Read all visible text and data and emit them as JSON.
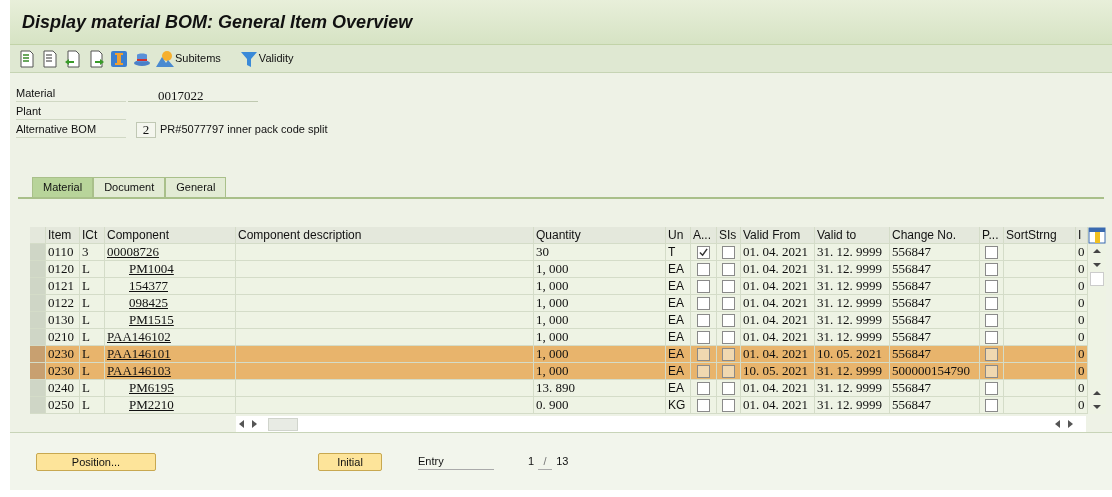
{
  "window": {
    "title": "Display material BOM: General Item Overview"
  },
  "toolbar": [
    {
      "kind": "icon"
    },
    {
      "kind": "icon"
    },
    {
      "kind": "icon"
    },
    {
      "kind": "icon"
    },
    {
      "kind": "icon"
    },
    {
      "kind": "icon"
    },
    {
      "kind": "text",
      "label": "Subitems"
    },
    {
      "kind": "text",
      "label": "Validity"
    }
  ],
  "header": {
    "material": {
      "label": "Material",
      "value": "0017022"
    },
    "plant": {
      "label": "Plant"
    },
    "alternative_bom": {
      "label": "Alternative BOM",
      "value": "2",
      "description": "PR#5077797 inner pack code split"
    }
  },
  "tabs": [
    {
      "label": "Material",
      "selected": true
    },
    {
      "label": "Document",
      "selected": false
    },
    {
      "label": "General",
      "selected": false
    }
  ],
  "table": {
    "columns": [
      "Item",
      "ICt",
      "Component",
      "Component description",
      "Quantity",
      "Un",
      "A...",
      "SIs",
      "Valid From",
      "Valid to",
      "Change No.",
      "P...",
      "SortStrng",
      "I"
    ],
    "rows": [
      {
        "item": "0110",
        "ict": "3",
        "component": "00008726",
        "quantity": "30",
        "unit": "T",
        "a": true,
        "sis": false,
        "valid_from": "01. 04. 2021",
        "valid_to": "31. 12. 9999",
        "change_no": "556847",
        "p": false,
        "col_i": "0",
        "selected": false
      },
      {
        "item": "0120",
        "ict": "L",
        "component": "PM1004",
        "quantity": "1, 000",
        "unit": "EA",
        "a": false,
        "sis": false,
        "valid_from": "01. 04. 2021",
        "valid_to": "31. 12. 9999",
        "change_no": "556847",
        "p": false,
        "col_i": "0",
        "selected": false
      },
      {
        "item": "0121",
        "ict": "L",
        "component": "154377",
        "quantity": "1, 000",
        "unit": "EA",
        "a": false,
        "sis": false,
        "valid_from": "01. 04. 2021",
        "valid_to": "31. 12. 9999",
        "change_no": "556847",
        "p": false,
        "col_i": "0",
        "selected": false
      },
      {
        "item": "0122",
        "ict": "L",
        "component": "098425",
        "quantity": "1, 000",
        "unit": "EA",
        "a": false,
        "sis": false,
        "valid_from": "01. 04. 2021",
        "valid_to": "31. 12. 9999",
        "change_no": "556847",
        "p": false,
        "col_i": "0",
        "selected": false
      },
      {
        "item": "0130",
        "ict": "L",
        "component": "PM1515",
        "quantity": "1, 000",
        "unit": "EA",
        "a": false,
        "sis": false,
        "valid_from": "01. 04. 2021",
        "valid_to": "31. 12. 9999",
        "change_no": "556847",
        "p": false,
        "col_i": "0",
        "selected": false
      },
      {
        "item": "0210",
        "ict": "L",
        "component": "PAA146102",
        "quantity": "1, 000",
        "unit": "EA",
        "a": false,
        "sis": false,
        "valid_from": "01. 04. 2021",
        "valid_to": "31. 12. 9999",
        "change_no": "556847",
        "p": false,
        "col_i": "0",
        "selected": false
      },
      {
        "item": "0230",
        "ict": "L",
        "component": "PAA146101",
        "quantity": "1, 000",
        "unit": "EA",
        "a": false,
        "sis": false,
        "valid_from": "01. 04. 2021",
        "valid_to": "10. 05. 2021",
        "change_no": "556847",
        "p": false,
        "col_i": "0",
        "selected": true
      },
      {
        "item": "0230",
        "ict": "L",
        "component": "PAA146103",
        "quantity": "1, 000",
        "unit": "EA",
        "a": false,
        "sis": false,
        "valid_from": "10. 05. 2021",
        "valid_to": "31. 12. 9999",
        "change_no": "500000154790",
        "p": false,
        "col_i": "0",
        "selected": true
      },
      {
        "item": "0240",
        "ict": "L",
        "component": "PM6195",
        "quantity": "13. 890",
        "unit": "EA",
        "a": false,
        "sis": false,
        "valid_from": "01. 04. 2021",
        "valid_to": "31. 12. 9999",
        "change_no": "556847",
        "p": false,
        "col_i": "0",
        "selected": false
      },
      {
        "item": "0250",
        "ict": "L",
        "component": "PM2210",
        "quantity": "0. 900",
        "unit": "KG",
        "a": false,
        "sis": false,
        "valid_from": "01. 04. 2021",
        "valid_to": "31. 12. 9999",
        "change_no": "556847",
        "p": false,
        "col_i": "0",
        "selected": false
      }
    ]
  },
  "footer": {
    "position_button": "Position...",
    "initial_button": "Initial",
    "entry_label": "Entry",
    "page": "1",
    "separator": "/",
    "total": "13"
  }
}
